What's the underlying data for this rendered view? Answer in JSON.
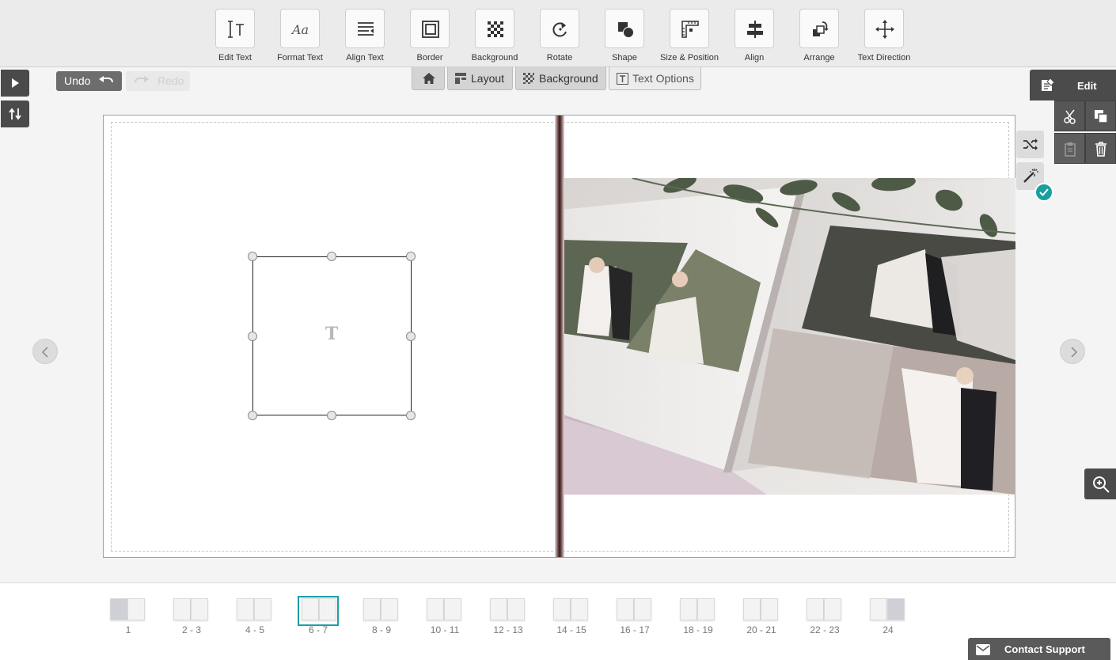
{
  "toolbar": {
    "tools": [
      {
        "label": "Edit Text",
        "icon": "edit-text-icon"
      },
      {
        "label": "Format Text",
        "icon": "format-text-icon"
      },
      {
        "label": "Align Text",
        "icon": "align-text-icon"
      },
      {
        "label": "Border",
        "icon": "border-icon"
      },
      {
        "label": "Background",
        "icon": "background-icon"
      },
      {
        "label": "Rotate",
        "icon": "rotate-icon"
      },
      {
        "label": "Shape",
        "icon": "shape-icon"
      },
      {
        "label": "Size & Position",
        "icon": "size-position-icon"
      },
      {
        "label": "Align",
        "icon": "align-icon"
      },
      {
        "label": "Arrange",
        "icon": "arrange-icon"
      },
      {
        "label": "Text Direction",
        "icon": "text-direction-icon"
      }
    ]
  },
  "history": {
    "undo_label": "Undo",
    "redo_label": "Redo"
  },
  "tabs": {
    "layout": "Layout",
    "background": "Background",
    "text_options": "Text Options"
  },
  "edit_panel": {
    "title": "Edit"
  },
  "canvas": {
    "placeholder_glyph": "T"
  },
  "pages": {
    "labels": [
      "1",
      "2 - 3",
      "4 - 5",
      "6 - 7",
      "8 - 9",
      "10 - 11",
      "12 - 13",
      "14 - 15",
      "16 - 17",
      "18 - 19",
      "20 - 21",
      "22 - 23",
      "24"
    ],
    "active": "6 - 7"
  },
  "support": {
    "label": "Contact Support"
  },
  "colors": {
    "accent": "#1aa0a8",
    "toolbar_bg": "#ebebeb",
    "dark_button": "#4b4b4b"
  }
}
